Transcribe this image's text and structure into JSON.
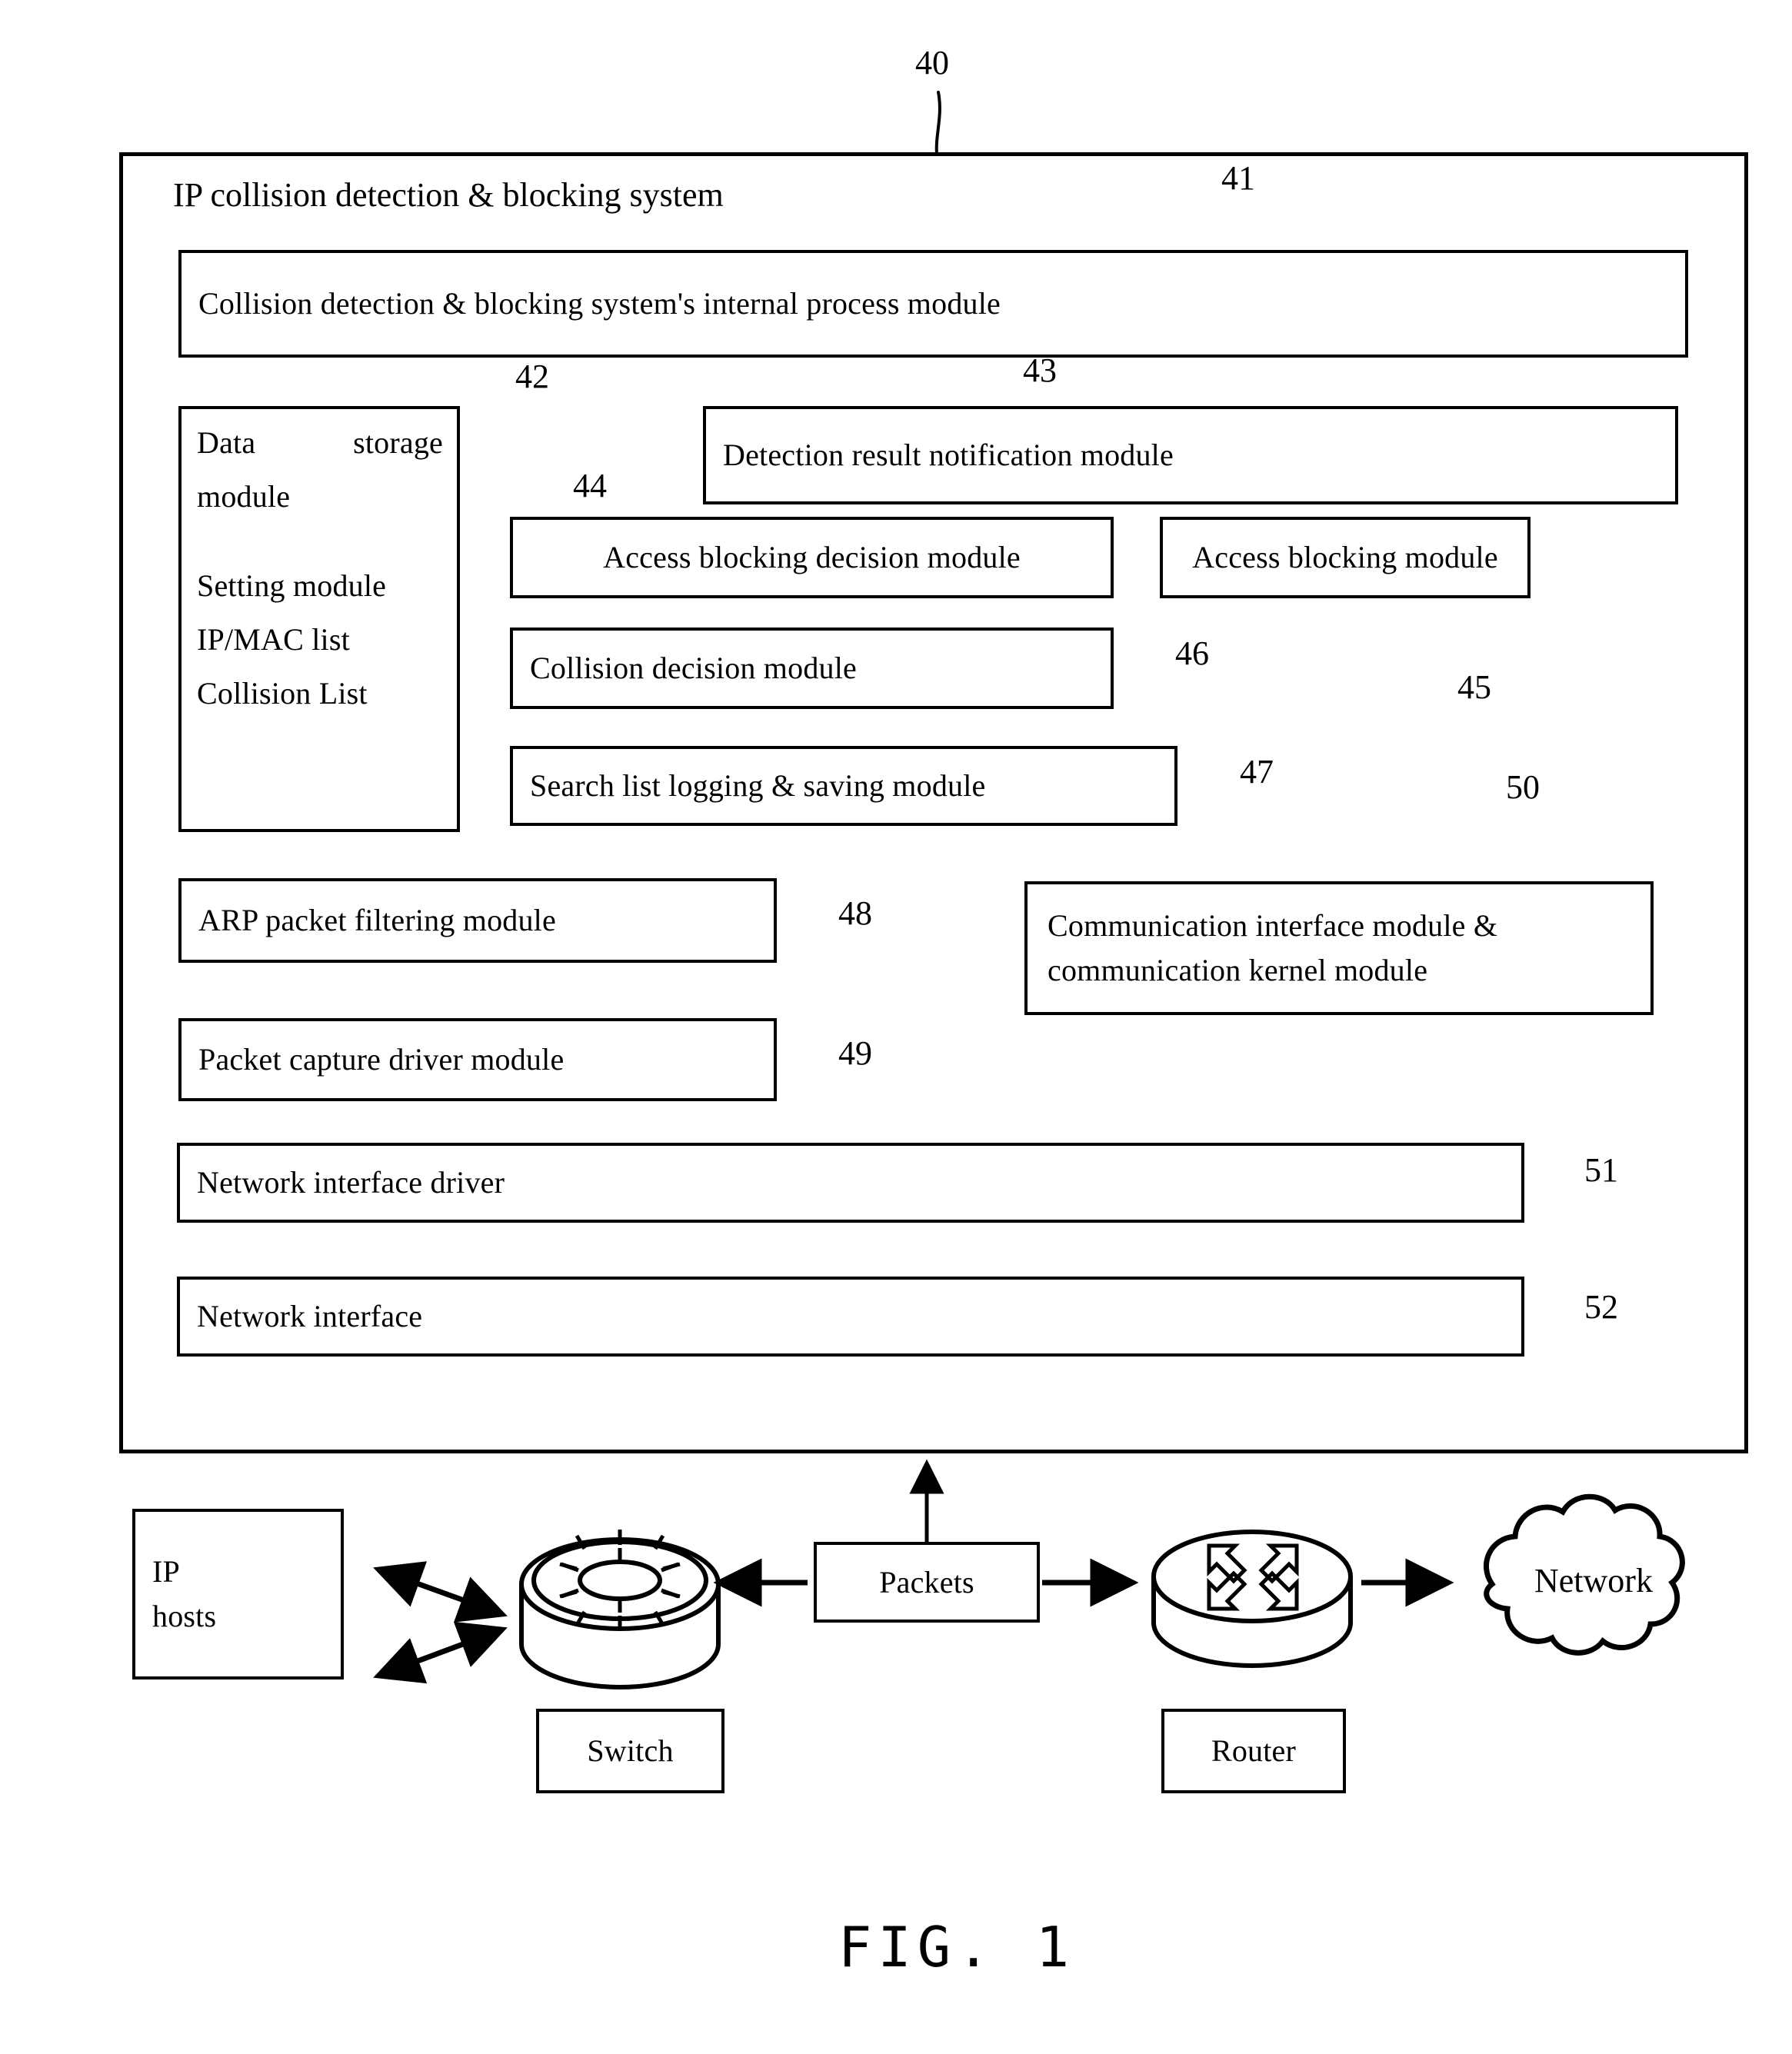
{
  "figure": {
    "caption": "FIG. 1",
    "system_label": "40",
    "system_title": "IP collision detection & blocking system"
  },
  "modules": {
    "internal_process": {
      "label": "Collision detection & blocking system's internal process module",
      "ref": "41"
    },
    "data_storage": {
      "title_left": "Data",
      "title_right": "storage",
      "title_second": "module",
      "items": [
        "Setting module",
        "IP/MAC list",
        "Collision List"
      ],
      "ref": "42"
    },
    "detection_notification": {
      "label": "Detection result notification module",
      "ref": "43"
    },
    "access_blocking_decision": {
      "label": "Access blocking decision module",
      "ref": "44"
    },
    "access_blocking": {
      "label": "Access blocking module",
      "ref": "45"
    },
    "collision_decision": {
      "label": "Collision decision module",
      "ref": "46"
    },
    "search_list_logging": {
      "label": "Search list logging & saving module",
      "ref": "47"
    },
    "arp_filtering": {
      "label": "ARP packet filtering module",
      "ref": "48"
    },
    "packet_capture": {
      "label": "Packet capture driver module",
      "ref": "49"
    },
    "communication": {
      "line1": "Communication interface module &",
      "line2": "communication kernel module",
      "ref": "50"
    },
    "network_interface_driver": {
      "label": "Network interface driver",
      "ref": "51"
    },
    "network_interface": {
      "label": "Network interface",
      "ref": "52"
    }
  },
  "network": {
    "ip_hosts": {
      "line1": "IP",
      "line2": "hosts"
    },
    "switch_label": "Switch",
    "packets_label": "Packets",
    "router_label": "Router",
    "cloud_label": "Network"
  },
  "colors": {
    "ink": "#000000",
    "paper": "#ffffff"
  }
}
